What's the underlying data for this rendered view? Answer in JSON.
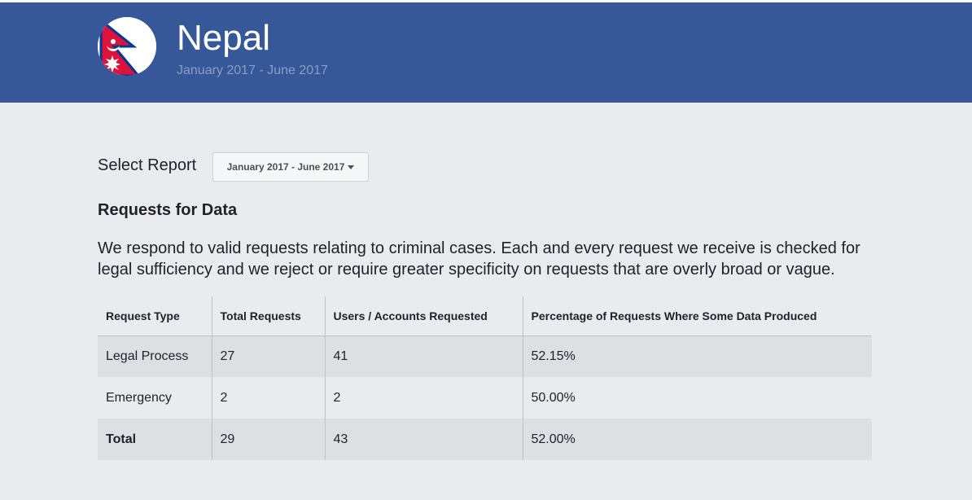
{
  "header": {
    "country": "Nepal",
    "period": "January 2017 - June 2017",
    "flag_icon": "nepal-flag-icon",
    "colors": {
      "bar": "#365899",
      "period_text": "#8b9dc3"
    }
  },
  "report_selector": {
    "label": "Select Report",
    "selected": "January 2017 - June 2017"
  },
  "section": {
    "title": "Requests for Data",
    "intro": "We respond to valid requests relating to criminal cases. Each and every request we receive is checked for legal sufficiency and we reject or require greater specificity on requests that are overly broad or vague."
  },
  "table": {
    "headers": [
      "Request Type",
      "Total Requests",
      "Users / Accounts Requested",
      "Percentage of Requests Where Some Data Produced"
    ],
    "rows": [
      [
        "Legal Process",
        "27",
        "41",
        "52.15%"
      ],
      [
        "Emergency",
        "2",
        "2",
        "50.00%"
      ],
      [
        "Total",
        "29",
        "43",
        "52.00%"
      ]
    ]
  }
}
